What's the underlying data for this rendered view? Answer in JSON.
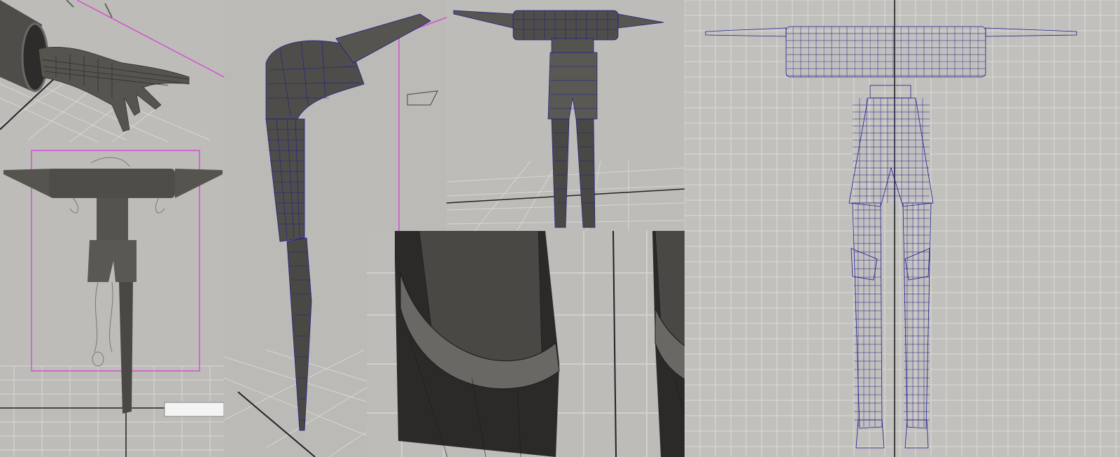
{
  "collage": {
    "panels": [
      {
        "id": "hand-closeup",
        "view": "perspective",
        "subject": "hand-and-sleeve"
      },
      {
        "id": "front-shaded",
        "view": "front",
        "subject": "full-body-shaded"
      },
      {
        "id": "side-wireframe",
        "view": "side",
        "subject": "body-wireframe-on-shaded"
      },
      {
        "id": "front-perspective",
        "view": "perspective",
        "subject": "full-body-wireframe-on-shaded"
      },
      {
        "id": "knee-closeup",
        "view": "perspective",
        "subject": "knee-pads-closeup"
      },
      {
        "id": "front-wireframe",
        "view": "front-orthographic",
        "subject": "full-body-wireframe"
      }
    ]
  },
  "colors": {
    "viewport_bg": "#bcbab6",
    "grid_line": "#d8d6d2",
    "grid_major": "#222222",
    "mesh_shaded": "#4f4d49",
    "mesh_dark": "#3a3835",
    "wire_blue": "#1c1c8f",
    "selection_magenta": "#d44fd4"
  }
}
